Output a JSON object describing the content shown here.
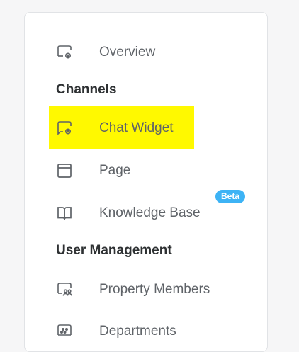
{
  "nav": {
    "overview": {
      "label": "Overview",
      "icon": "monitor-gear-icon"
    },
    "channels_title": "Channels",
    "chat_widget": {
      "label": "Chat Widget",
      "icon": "chat-gear-icon"
    },
    "page": {
      "label": "Page",
      "icon": "window-icon"
    },
    "knowledge_base": {
      "label": "Knowledge Base",
      "icon": "book-icon",
      "badge": "Beta"
    },
    "user_management_title": "User Management",
    "property_members": {
      "label": "Property Members",
      "icon": "members-icon"
    },
    "departments": {
      "label": "Departments",
      "icon": "departments-icon"
    }
  },
  "colors": {
    "highlight": "#fff900",
    "badge": "#3db3f5",
    "text": "#5f6368",
    "heading": "#2e3133"
  }
}
